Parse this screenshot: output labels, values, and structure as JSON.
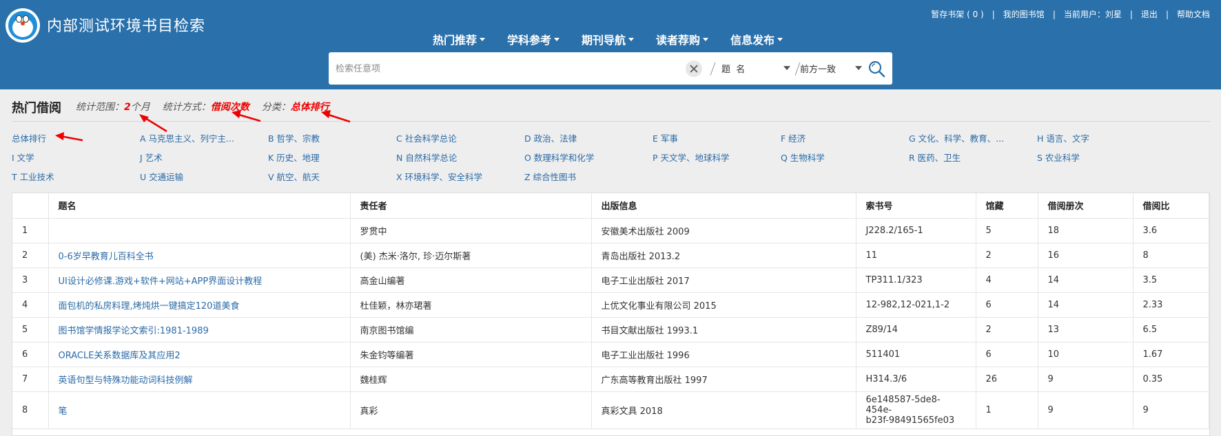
{
  "header": {
    "site_title": "内部测试环境书目检索",
    "bookshelf": "暂存书架 ( 0 )",
    "my_library": "我的图书馆",
    "current_user": "当前用户：刘星",
    "logout": "退出",
    "help": "帮助文档",
    "separator": "|"
  },
  "nav": [
    {
      "label": "热门推荐"
    },
    {
      "label": "学科参考"
    },
    {
      "label": "期刊导航"
    },
    {
      "label": "读者荐购"
    },
    {
      "label": "信息发布"
    }
  ],
  "search": {
    "placeholder": "检索任意项",
    "field": "题  名",
    "match": "前方一致"
  },
  "section": {
    "title": "热门借阅",
    "range_label": "统计范围：",
    "range_num": "2",
    "range_unit": "个月",
    "method_label": "统计方式：",
    "method_value": "借阅次数",
    "category_label": "分类：",
    "category_value": "总体排行"
  },
  "categories": [
    "总体排行",
    "A 马克思主义、列宁主...",
    "B 哲学、宗教",
    "C 社会科学总论",
    "D 政治、法律",
    "E 军事",
    "F 经济",
    "G 文化、科学、教育、...",
    "H 语言、文字",
    "I 文学",
    "J 艺术",
    "K 历史、地理",
    "N 自然科学总论",
    "O 数理科学和化学",
    "P 天文学、地球科学",
    "Q 生物科学",
    "R 医药、卫生",
    "S 农业科学",
    "T 工业技术",
    "U 交通运输",
    "V 航空、航天",
    "X 环境科学、安全科学",
    "Z 综合性图书"
  ],
  "table": {
    "headers": [
      "",
      "题名",
      "责任者",
      "出版信息",
      "索书号",
      "馆藏",
      "借阅册次",
      "借阅比"
    ],
    "rows": [
      [
        "1",
        "",
        "罗贯中",
        "安徽美术出版社 2009",
        "J228.2/165-1",
        "5",
        "18",
        "3.6"
      ],
      [
        "2",
        "0-6岁早教育儿百科全书",
        "(美) 杰米·洛尔, 珍·迈尔斯著",
        "青岛出版社 2013.2",
        "11",
        "2",
        "16",
        "8"
      ],
      [
        "3",
        "UI设计必修课.游戏+软件+网站+APP界面设计教程",
        "高金山编著",
        "电子工业出版社 2017",
        "TP311.1/323",
        "4",
        "14",
        "3.5"
      ],
      [
        "4",
        "面包机的私房料理,烤炖烘一键搞定120道美食",
        "杜佳颖，林亦珺著",
        "上优文化事业有限公司 2015",
        "12-982,12-021,1-2",
        "6",
        "14",
        "2.33"
      ],
      [
        "5",
        "图书馆学情报学论文索引:1981-1989",
        "南京图书馆编",
        "书目文献出版社 1993.1",
        "Z89/14",
        "2",
        "13",
        "6.5"
      ],
      [
        "6",
        "ORACLE关系数据库及其应用2",
        "朱金钧等编著",
        "电子工业出版社 1996",
        "511401",
        "6",
        "10",
        "1.67"
      ],
      [
        "7",
        "英语句型与特殊功能动词科技例解",
        "魏桂辉",
        "广东高等教育出版社 1997",
        "H314.3/6",
        "26",
        "9",
        "0.35"
      ],
      [
        "8",
        "笔",
        "真彩",
        "真彩文具 2018",
        "6e148587-5de8-454e-b23f-98491565fe03",
        "1",
        "9",
        "9"
      ]
    ],
    "callno_8a": "6e148587-5de8-454e-",
    "callno_8b": "b23f-98491565fe03"
  }
}
